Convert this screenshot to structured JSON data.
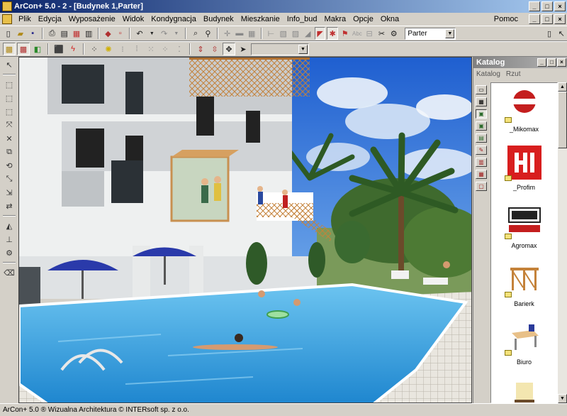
{
  "window": {
    "title": "ArCon+ 5.0 - 2 - [Budynek 1,Parter]",
    "minimize": "_",
    "maximize": "□",
    "close": "×"
  },
  "menu": {
    "items": [
      "Plik",
      "Edycja",
      "Wyposażenie",
      "Widok",
      "Kondygnacja",
      "Budynek",
      "Mieszkanie",
      "Info_bud",
      "Makra",
      "Opcje",
      "Okna"
    ],
    "help": "Pomoc"
  },
  "toolbar": {
    "floor_select": "Parter",
    "empty_select": ""
  },
  "catalog": {
    "title": "Katalog",
    "tabs": [
      "Katalog",
      "Rzut"
    ],
    "items": [
      {
        "label": "_Mikomax"
      },
      {
        "label": "_Profim"
      },
      {
        "label": "Agromax"
      },
      {
        "label": "Barierk"
      },
      {
        "label": "Biuro"
      }
    ]
  },
  "status": {
    "text": "ArCon+ 5.0 ® Wizualna Architektura © INTERsoft sp. z o.o."
  },
  "colors": {
    "titlebar_start": "#0a246a",
    "titlebar_end": "#a6caf0",
    "pool_water": "#2f9ad6",
    "sky": "#2d6fd6"
  }
}
